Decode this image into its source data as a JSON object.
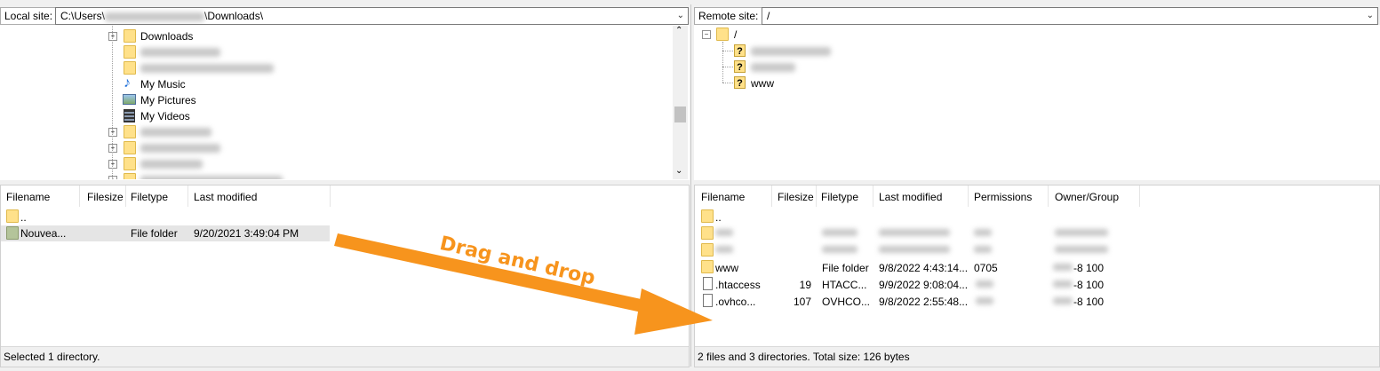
{
  "local": {
    "site_label": "Local site:",
    "path_start": "C:\\Users\\",
    "path_end": "\\Downloads\\",
    "tree": [
      {
        "label": "Downloads",
        "icon": "folder",
        "expander": "+"
      },
      {
        "label": "",
        "icon": "folder",
        "expander": "",
        "blurred": true
      },
      {
        "label": "",
        "icon": "folder",
        "expander": "",
        "blurred": true
      },
      {
        "label": "My Music",
        "icon": "music-note",
        "expander": ""
      },
      {
        "label": "My Pictures",
        "icon": "pictures",
        "expander": ""
      },
      {
        "label": "My Videos",
        "icon": "videos",
        "expander": ""
      },
      {
        "label": "",
        "icon": "folder",
        "expander": "+",
        "blurred": true
      },
      {
        "label": "",
        "icon": "folder",
        "expander": "+",
        "blurred": true
      },
      {
        "label": "",
        "icon": "folder",
        "expander": "+",
        "blurred": true
      },
      {
        "label": "",
        "icon": "folder",
        "expander": "+",
        "blurred": true
      }
    ],
    "columns": [
      "Filename",
      "Filesize",
      "Filetype",
      "Last modified"
    ],
    "files": [
      {
        "name": "..",
        "size": "",
        "type": "",
        "modified": ""
      },
      {
        "name": "Nouvea...",
        "size": "",
        "type": "File folder",
        "modified": "9/20/2021 3:49:04 PM"
      }
    ],
    "status": "Selected 1 directory."
  },
  "remote": {
    "site_label": "Remote site:",
    "path": "/",
    "tree_root": "/",
    "tree": [
      {
        "label": "",
        "blurred": true
      },
      {
        "label": "",
        "blurred": true
      },
      {
        "label": "www"
      }
    ],
    "columns": [
      "Filename",
      "Filesize",
      "Filetype",
      "Last modified",
      "Permissions",
      "Owner/Group"
    ],
    "files": [
      {
        "name": "..",
        "size": "",
        "type": "",
        "modified": "",
        "perms": "",
        "owner": ""
      },
      {
        "name": "",
        "size": "",
        "type": "",
        "modified": "",
        "perms": "",
        "owner": "",
        "blurred": true
      },
      {
        "name": "",
        "size": "",
        "type": "",
        "modified": "",
        "perms": "",
        "owner": "",
        "blurred": true
      },
      {
        "name": "www",
        "size": "",
        "type": "File folder",
        "modified": "9/8/2022 4:43:14...",
        "perms": "0705",
        "owner": "-8 100"
      },
      {
        "name": ".htaccess",
        "size": "19",
        "type": "HTACC...",
        "modified": "9/9/2022 9:08:04...",
        "perms": "",
        "owner": "-8 100"
      },
      {
        "name": ".ovhco...",
        "size": "107",
        "type": "OVHCO...",
        "modified": "9/8/2022 2:55:48...",
        "perms": "",
        "owner": "-8 100"
      }
    ],
    "status": "2 files and 3 directories. Total size: 126 bytes"
  },
  "annotation": {
    "text": "Drag and drop",
    "color": "#f7941d"
  }
}
